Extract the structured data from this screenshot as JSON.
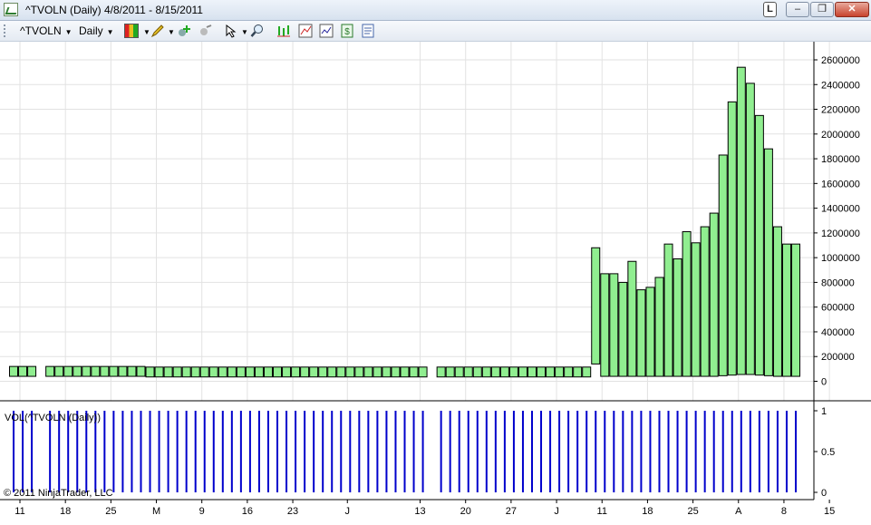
{
  "window": {
    "title": "^TVOLN (Daily)  4/8/2011 - 8/15/2011",
    "button_l": "L",
    "minimize": "–",
    "maximize": "❐",
    "close": "✕"
  },
  "toolbar": {
    "instrument": "^TVOLN",
    "interval": "Daily"
  },
  "chart_data": [
    {
      "type": "bar",
      "title": "",
      "xlabel": "",
      "ylabel": "",
      "ylim": [
        -100000,
        2700000
      ],
      "y_ticks": [
        0,
        200000,
        400000,
        600000,
        800000,
        1000000,
        1200000,
        1400000,
        1600000,
        1800000,
        2000000,
        2200000,
        2400000,
        2600000
      ],
      "y_tick_labels": [
        "0",
        "200000",
        "400000",
        "600000",
        "800000",
        "1000000",
        "1200000",
        "1400000",
        "1600000",
        "1800000",
        "2000000",
        "2200000",
        "2400000",
        "2600000"
      ],
      "x_tick_labels": [
        "11",
        "18",
        "25",
        "M",
        "9",
        "16",
        "23",
        "J",
        "13",
        "20",
        "27",
        "J",
        "11",
        "18",
        "25",
        "A",
        "8",
        "15"
      ],
      "grid": true,
      "bar_color": "#90ee90",
      "bar_edge_color": "#000000",
      "series": [
        {
          "low": [
            40000,
            40000,
            40000,
            null,
            40000,
            40000,
            40000,
            40000,
            40000,
            40000,
            40000,
            40000,
            40000,
            40000,
            40000,
            35000,
            35000,
            35000,
            35000,
            35000,
            35000,
            35000,
            35000,
            35000,
            35000,
            35000,
            35000,
            35000,
            35000,
            35000,
            35000,
            35000,
            35000,
            35000,
            35000,
            35000,
            35000,
            35000,
            35000,
            35000,
            35000,
            35000,
            35000,
            35000,
            35000,
            35000,
            null,
            35000,
            35000,
            35000,
            35000,
            35000,
            35000,
            35000,
            35000,
            35000,
            35000,
            35000,
            35000,
            35000,
            35000,
            35000,
            35000,
            35000,
            140000,
            40000,
            40000,
            40000,
            40000,
            40000,
            40000,
            40000,
            40000,
            40000,
            40000,
            40000,
            40000,
            40000,
            45000,
            50000,
            55000,
            55000,
            50000,
            45000,
            40000,
            40000,
            40000
          ],
          "high": [
            120000,
            120000,
            120000,
            null,
            120000,
            120000,
            120000,
            120000,
            120000,
            120000,
            120000,
            120000,
            120000,
            120000,
            120000,
            115000,
            115000,
            115000,
            115000,
            115000,
            115000,
            115000,
            115000,
            115000,
            115000,
            115000,
            115000,
            115000,
            115000,
            115000,
            115000,
            115000,
            115000,
            115000,
            115000,
            115000,
            115000,
            115000,
            115000,
            115000,
            115000,
            115000,
            115000,
            115000,
            115000,
            115000,
            null,
            115000,
            115000,
            115000,
            115000,
            115000,
            115000,
            115000,
            115000,
            115000,
            115000,
            115000,
            115000,
            115000,
            115000,
            115000,
            115000,
            115000,
            1080000,
            870000,
            870000,
            800000,
            970000,
            740000,
            760000,
            840000,
            1110000,
            990000,
            1210000,
            1120000,
            1250000,
            1360000,
            1830000,
            2260000,
            2540000,
            2410000,
            2150000,
            1880000,
            1250000,
            1110000,
            1110000
          ]
        }
      ]
    },
    {
      "type": "bar",
      "title": "VOL(^TVOLN (Daily))",
      "ylim": [
        0,
        1
      ],
      "y_ticks": [
        0,
        0.5,
        1
      ],
      "y_tick_labels": [
        "0",
        "0.5",
        "1"
      ],
      "bar_color": "#0000cc",
      "values": [
        1,
        1,
        1,
        null,
        1,
        1,
        1,
        1,
        1,
        1,
        1,
        1,
        1,
        1,
        1,
        1,
        1,
        1,
        1,
        1,
        1,
        1,
        1,
        1,
        1,
        1,
        1,
        1,
        1,
        1,
        1,
        1,
        1,
        1,
        1,
        1,
        1,
        1,
        1,
        1,
        1,
        1,
        1,
        1,
        1,
        1,
        null,
        1,
        1,
        1,
        1,
        1,
        1,
        1,
        1,
        1,
        1,
        1,
        1,
        1,
        1,
        1,
        1,
        1,
        1,
        1,
        1,
        1,
        1,
        1,
        1,
        1,
        1,
        1,
        1,
        1,
        1,
        1,
        1,
        1,
        1,
        1,
        1,
        1,
        1,
        1,
        1
      ]
    }
  ],
  "copyright": "© 2011 NinjaTrader, LLC"
}
